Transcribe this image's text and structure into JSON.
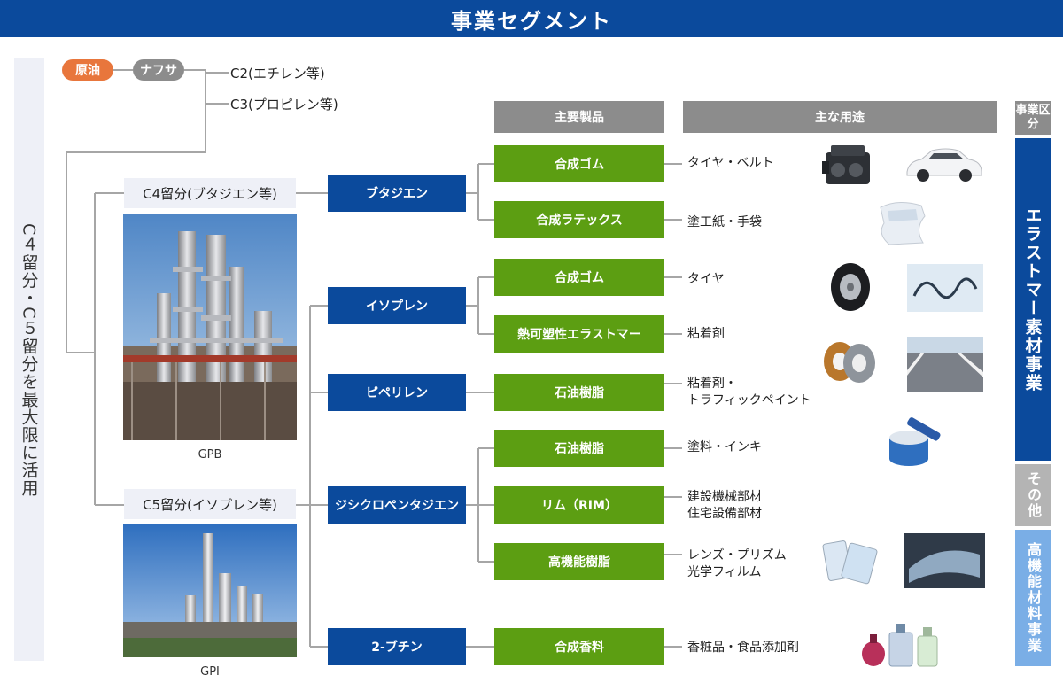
{
  "header": {
    "title": "事業セグメント"
  },
  "side_label": "C４留分・C５留分を最大限に活用",
  "feedstock": {
    "crude": "原油",
    "naphtha": "ナフサ"
  },
  "fractions": {
    "c2": "C2(エチレン等)",
    "c3": "C3(プロピレン等)"
  },
  "sources": {
    "c4": "C4留分(ブタジエン等)",
    "c5": "C5留分(イソプレン等)",
    "gpb": "GPB",
    "gpi": "GPI"
  },
  "column_headers": {
    "products": "主要製品",
    "uses": "主な用途",
    "division": "事業区分"
  },
  "materials": [
    {
      "key": "butadiene",
      "label": "ブタジエン"
    },
    {
      "key": "isoprene",
      "label": "イソプレン"
    },
    {
      "key": "piperylene",
      "label": "ピペリレン"
    },
    {
      "key": "dcpd",
      "label": "ジシクロペンタジエン"
    },
    {
      "key": "butene",
      "label": "2-ブチン"
    }
  ],
  "products": [
    {
      "label": "合成ゴム",
      "use": [
        "タイヤ・ベルト"
      ]
    },
    {
      "label": "合成ラテックス",
      "use": [
        "塗工紙・手袋"
      ]
    },
    {
      "label": "合成ゴム",
      "use": [
        "タイヤ"
      ]
    },
    {
      "label": "熱可塑性エラストマー",
      "use": [
        "粘着剤"
      ]
    },
    {
      "label": "石油樹脂",
      "use": [
        "粘着剤・",
        "トラフィックペイント"
      ]
    },
    {
      "label": "石油樹脂",
      "use": [
        "塗料・インキ"
      ]
    },
    {
      "label": "リム（RIM）",
      "use": [
        "建設機械部材",
        "住宅設備部材"
      ]
    },
    {
      "label": "高機能樹脂",
      "use": [
        "レンズ・プリズム",
        "光学フィルム"
      ]
    },
    {
      "label": "合成香料",
      "use": [
        "香粧品・食品添加剤"
      ]
    }
  ],
  "divisions": {
    "elastomer": "エラストマー素材事業",
    "other": "その他",
    "specialty": "高機能材料事業"
  },
  "icons": [
    "engine-icon",
    "car-icon",
    "glove-icon",
    "tire-icon",
    "tube-icon",
    "tape-icon",
    "road-icon",
    "paint-can-icon",
    "tablet-icon",
    "film-icon",
    "perfume-icon"
  ],
  "colors": {
    "header_blue": "#0b4a9c",
    "product_green": "#5c9e12",
    "column_gray": "#8c8c8c",
    "crude_orange": "#e8763c",
    "division_light_blue": "#7aaee6",
    "division_gray": "#b4b4b4"
  }
}
